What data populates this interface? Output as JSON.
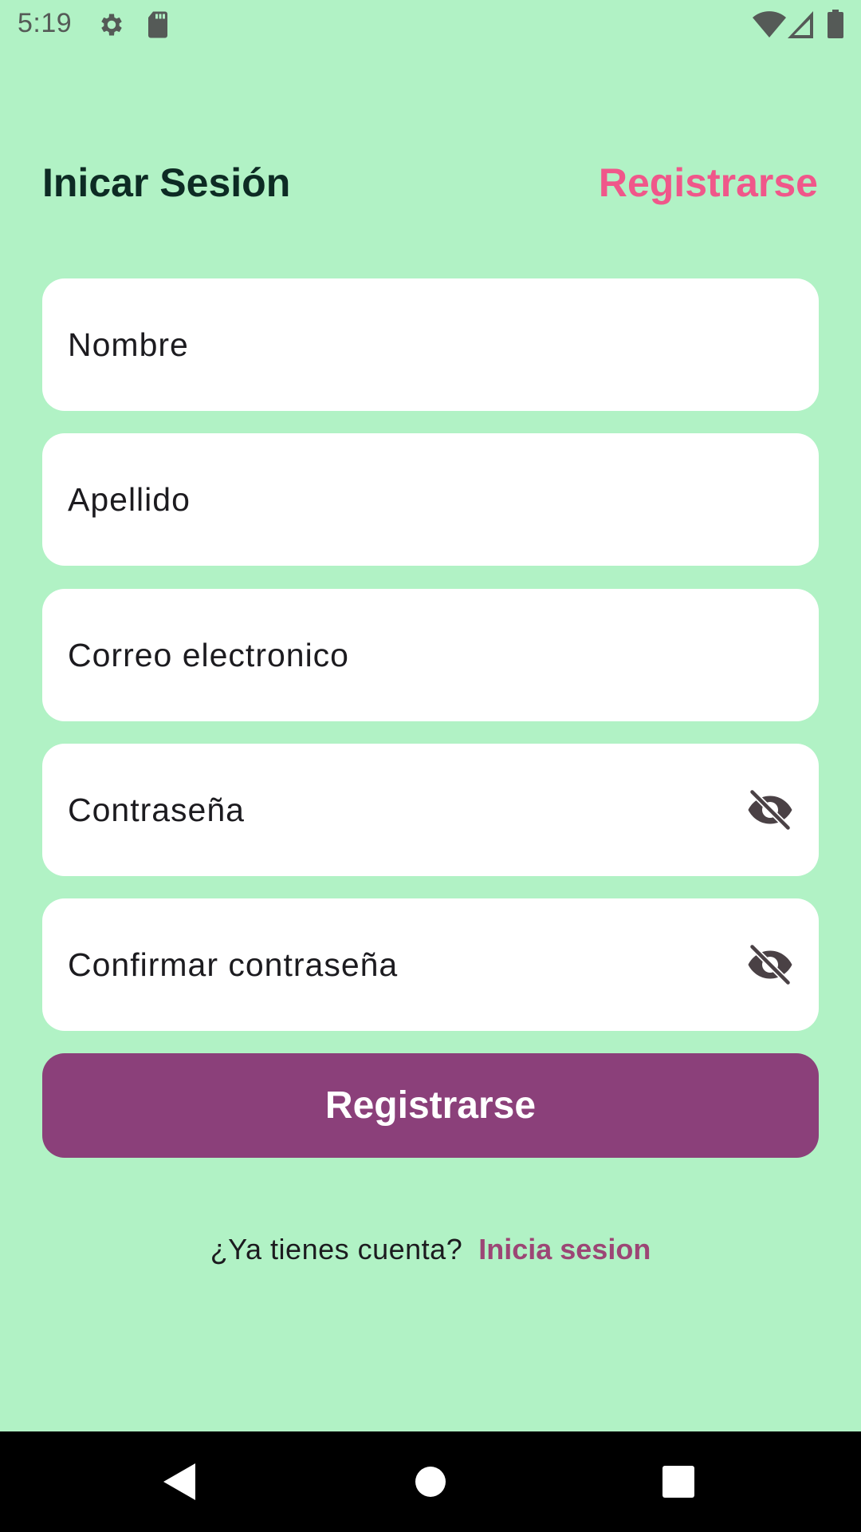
{
  "status_bar": {
    "time": "5:19",
    "icons": [
      "settings-gear-icon",
      "sd-card-icon",
      "wifi-icon",
      "cell-signal-icon",
      "battery-icon"
    ]
  },
  "header": {
    "title": "Inicar Sesión",
    "link": "Registrarse"
  },
  "form": {
    "fields": [
      {
        "placeholder": "Nombre",
        "type": "text"
      },
      {
        "placeholder": "Apellido",
        "type": "text"
      },
      {
        "placeholder": "Correo electronico",
        "type": "email"
      },
      {
        "placeholder": "Contraseña",
        "type": "password",
        "icon": "visibility-off-icon"
      },
      {
        "placeholder": "Confirmar contraseña",
        "type": "password",
        "icon": "visibility-off-icon"
      }
    ],
    "submit_label": "Registrarse"
  },
  "footer": {
    "text": "¿Ya tienes cuenta?",
    "link": "Inicia sesion"
  },
  "nav_bar": {
    "icons": [
      "back-triangle-icon",
      "home-circle-icon",
      "recents-square-icon"
    ]
  },
  "colors": {
    "background": "#b1f2c5",
    "header_link": "#f0578a",
    "button": "#8b407a",
    "footer_link": "#9c4675",
    "field_bg": "#ffffff"
  }
}
